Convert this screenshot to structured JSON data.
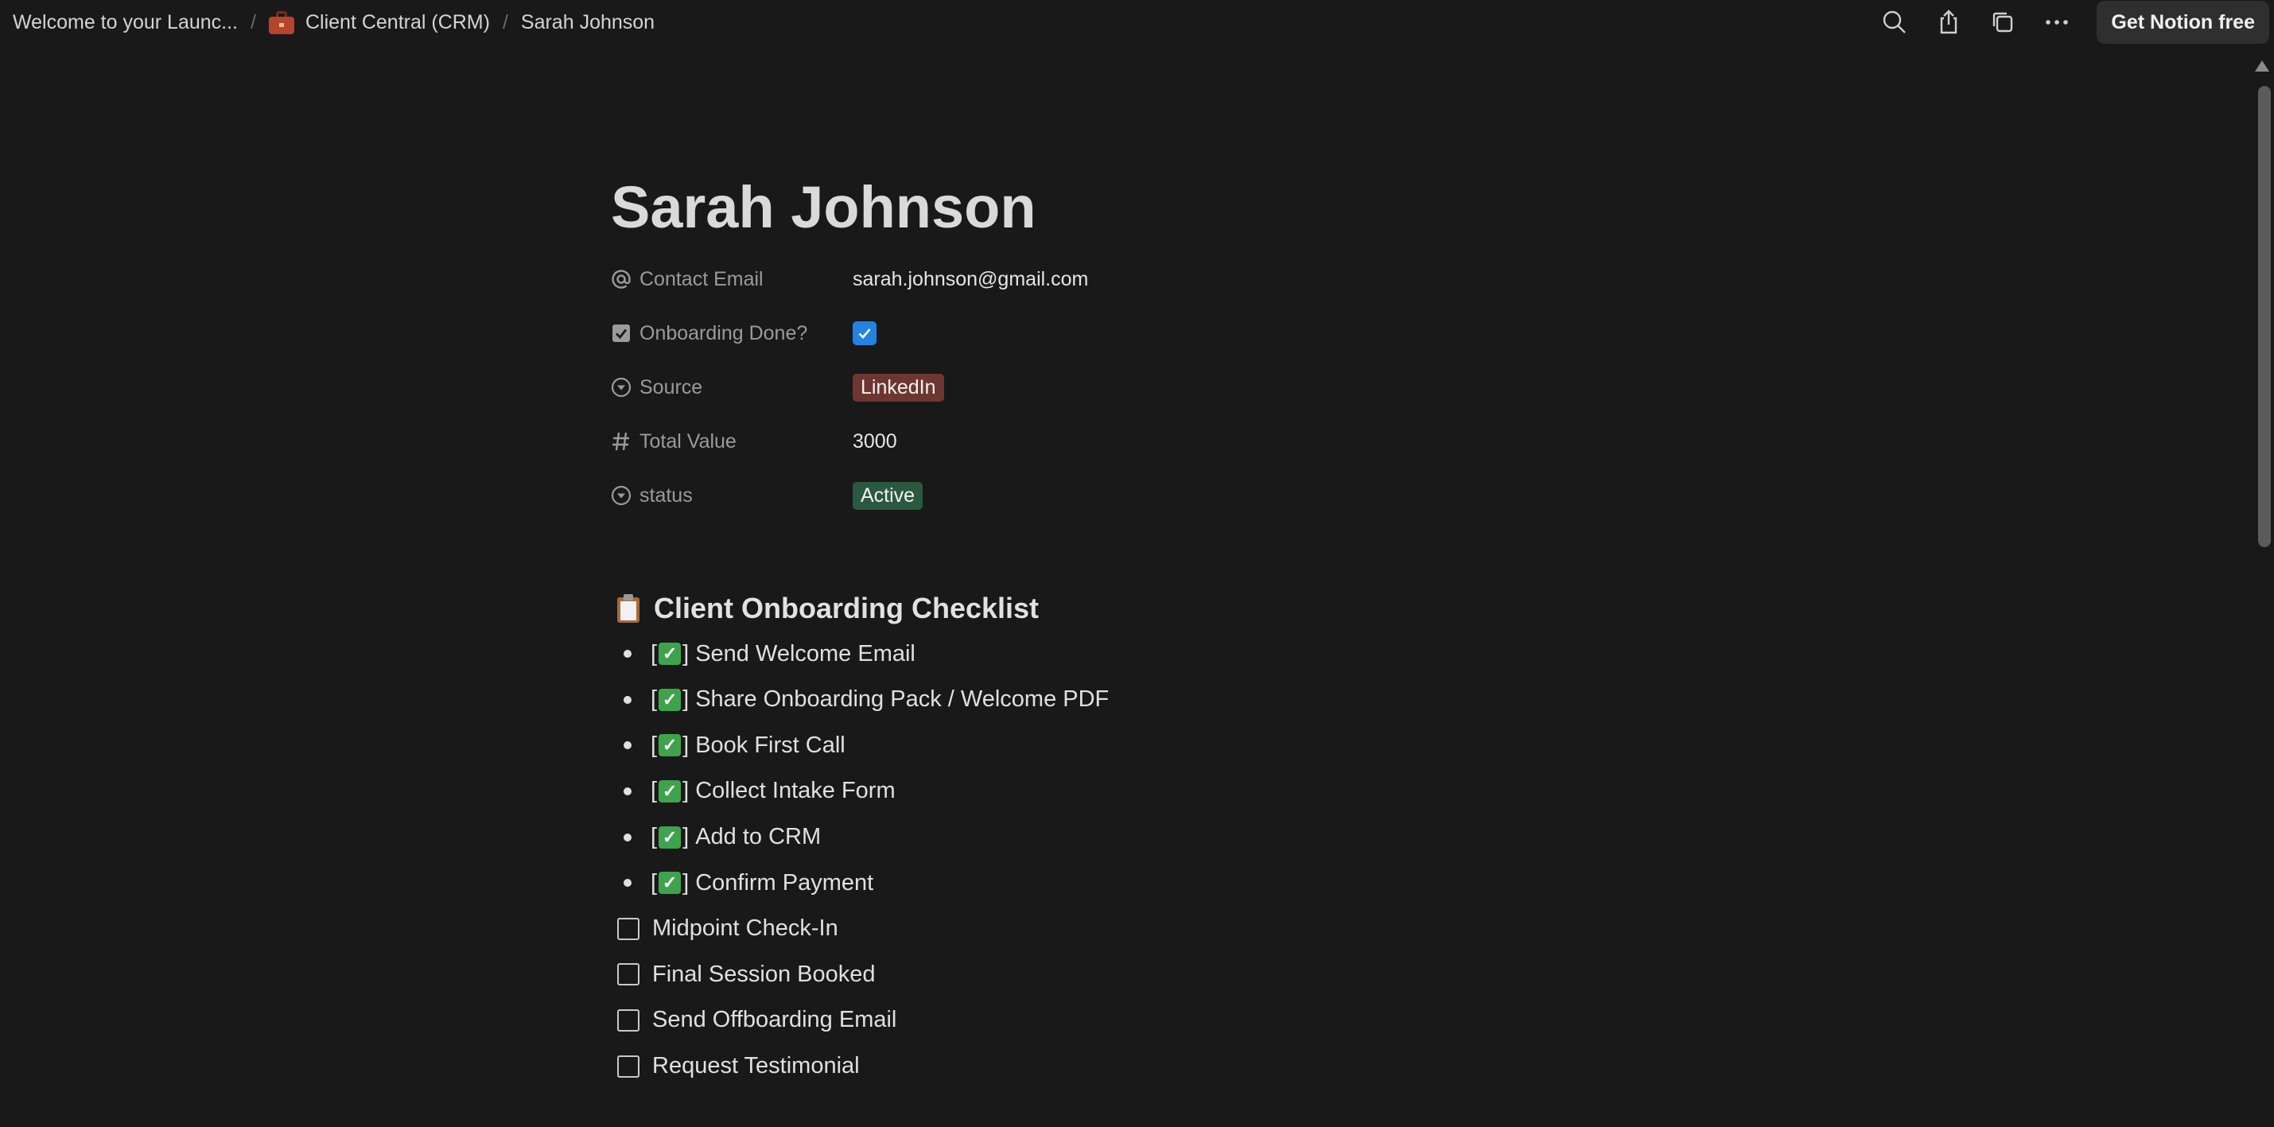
{
  "breadcrumb": {
    "items": [
      {
        "label": "Welcome to your Launc..."
      },
      {
        "label": "Client Central (CRM)",
        "icon": "briefcase-icon"
      },
      {
        "label": "Sarah Johnson"
      }
    ],
    "separator": "/"
  },
  "actions": {
    "search_icon": "search-icon",
    "share_icon": "share-icon",
    "duplicate_icon": "duplicate-icon",
    "more_icon": "more-icon",
    "cta_label": "Get Notion free"
  },
  "page": {
    "title": "Sarah Johnson",
    "properties": {
      "contact_email": {
        "name": "Contact Email",
        "value": "sarah.johnson@gmail.com"
      },
      "onboarding_done": {
        "name": "Onboarding Done?",
        "checked": true
      },
      "source": {
        "name": "Source",
        "value": "LinkedIn",
        "color": "#6e3630"
      },
      "total_value": {
        "name": "Total Value",
        "value": "3000"
      },
      "status": {
        "name": "status",
        "value": "Active",
        "color": "#2b593f"
      }
    },
    "checklist": {
      "title": "Client Onboarding Checklist",
      "icon": "clipboard-icon",
      "done_items": [
        "Send Welcome Email",
        "Share Onboarding Pack / Welcome PDF",
        "Book First Call",
        "Collect Intake Form",
        "Add to CRM",
        "Confirm Payment"
      ],
      "todo_items": [
        "Midpoint Check-In",
        "Final Session Booked",
        "Send Offboarding Email",
        "Request Testimonial"
      ]
    }
  },
  "colors": {
    "background": "#191919",
    "checkbox_accent": "#2383e2"
  }
}
